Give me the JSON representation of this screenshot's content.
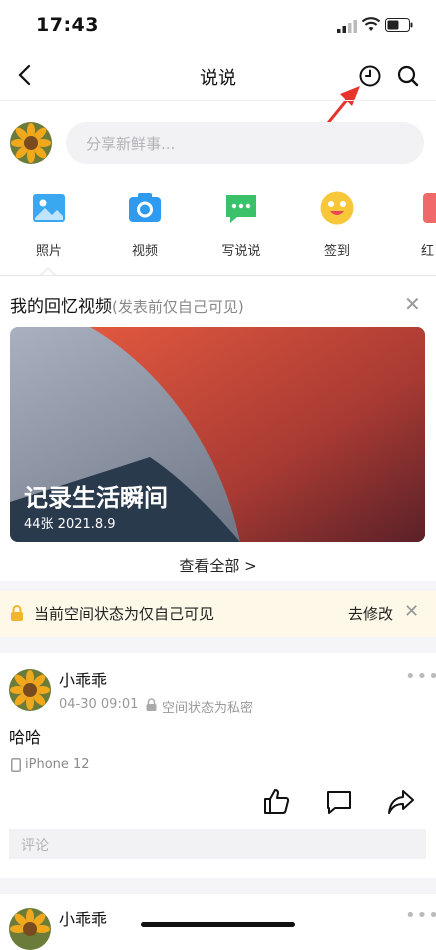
{
  "status_bar": {
    "time": "17:43"
  },
  "nav": {
    "title": "说说"
  },
  "composer": {
    "placeholder": "分享新鲜事..."
  },
  "quick_actions": [
    {
      "label": "照片",
      "icon": "photo-icon"
    },
    {
      "label": "视频",
      "icon": "camera-icon"
    },
    {
      "label": "写说说",
      "icon": "chat-icon"
    },
    {
      "label": "签到",
      "icon": "smiley-icon"
    },
    {
      "label": "红",
      "icon": "red-packet-icon"
    }
  ],
  "memory": {
    "title": "我的回忆视频",
    "subtitle": "(发表前仅自己可见)",
    "heading": "记录生活瞬间",
    "meta": "44张   2021.8.9",
    "view_all": "查看全部 >"
  },
  "privacy": {
    "text": "当前空间状态为仅自己可见",
    "action": "去修改"
  },
  "post": {
    "author": "小乖乖",
    "time": "04-30 09:01",
    "privacy": "空间状态为私密",
    "text": "哈哈",
    "device": "iPhone 12",
    "comment_placeholder": "评论"
  },
  "post2": {
    "author": "小乖乖"
  },
  "colors": {
    "accent_blue": "#2f9bf0",
    "chat_green": "#3cc16b",
    "smile_yellow": "#f7c739",
    "banner_bg": "#fdf8e8"
  }
}
